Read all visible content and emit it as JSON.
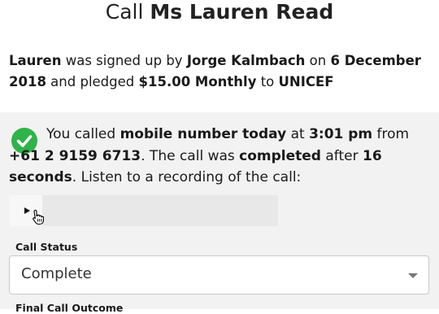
{
  "header": {
    "title_prefix": "Call",
    "title_name": "Ms Lauren Read"
  },
  "summary": {
    "name": "Lauren",
    "t1": " was signed up by ",
    "agent": "Jorge Kalmbach",
    "t2": " on ",
    "date": "6 December 2018",
    "t3": " and pledged ",
    "amount": "$15.00 Monthly",
    "t4": " to ",
    "charity": "UNICEF"
  },
  "call": {
    "t1": "You called ",
    "number_label": "mobile number today",
    "t2": " at ",
    "time": "3:01 pm",
    "t3": " from ",
    "from_number": "+61 2 9159 6713",
    "t4": ". The call was ",
    "status_word": "completed",
    "t5": " after ",
    "duration": "16 seconds",
    "t6": ". Listen to a recording of the call:"
  },
  "form": {
    "call_status_label": "Call Status",
    "call_status_value": "Complete",
    "final_outcome_label": "Final Call Outcome"
  },
  "colors": {
    "success": "#2fb34a",
    "section_bg": "#f2f2f2"
  },
  "icons": {
    "success": "check-circle-icon",
    "play": "play-icon",
    "dropdown": "chevron-down-icon",
    "cursor": "hand-pointer-icon"
  }
}
